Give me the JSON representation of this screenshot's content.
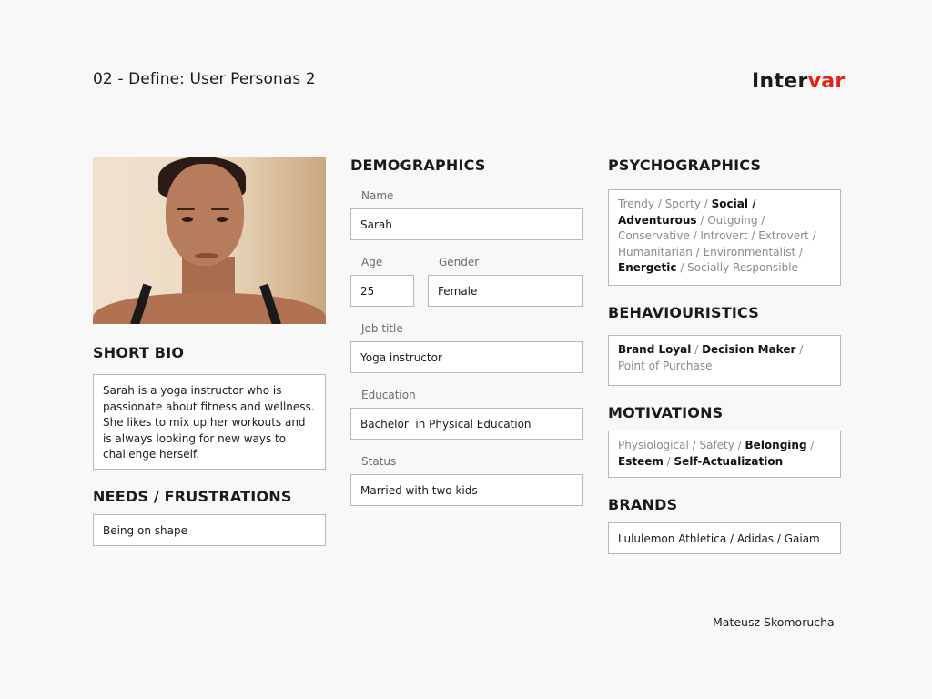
{
  "header": {
    "title": "02 - Define: User Personas 2",
    "logo": {
      "part1": "Inter",
      "part2": "var",
      "accent_color": "#e2231a"
    }
  },
  "left": {
    "photo_alt": "Portrait of Sarah",
    "bio_heading": "SHORT BIO",
    "bio_text": "Sarah is a yoga instructor who is passionate about fitness and wellness. She likes to mix up her workouts and is always looking for new ways to challenge herself.",
    "needs_heading": "NEEDS / FRUSTRATIONS",
    "needs_text": "Being on shape"
  },
  "demographics": {
    "heading": "DEMOGRAPHICS",
    "name": {
      "label": "Name",
      "value": "Sarah"
    },
    "age": {
      "label": "Age",
      "value": "25"
    },
    "gender": {
      "label": "Gender",
      "value": "Female"
    },
    "job": {
      "label": "Job title",
      "value": "Yoga instructor"
    },
    "education": {
      "label": "Education",
      "value": "Bachelor  in Physical Education"
    },
    "status": {
      "label": "Status",
      "value": "Married with two kids"
    }
  },
  "psychographics": {
    "heading": "PSYCHOGRAPHICS",
    "items": [
      {
        "text": "Trendy",
        "selected": false
      },
      {
        "text": "Sporty",
        "selected": false
      },
      {
        "text": "Social / Adventurous",
        "selected": true
      },
      {
        "text": "Outgoing ",
        "selected": false
      },
      {
        "text": "Conservative ",
        "selected": false
      },
      {
        "text": "Introvert ",
        "selected": false
      },
      {
        "text": "Extrovert",
        "selected": false
      },
      {
        "text": "Humanitarian",
        "selected": false
      },
      {
        "text": "Environmentalist",
        "selected": false
      },
      {
        "text": "Energetic",
        "selected": true
      },
      {
        "text": "Socially Responsible",
        "selected": false
      }
    ]
  },
  "behaviouristics": {
    "heading": "BEHAVIOURISTICS",
    "items": [
      {
        "text": "Brand Loyal",
        "selected": true
      },
      {
        "text": "Decision Maker",
        "selected": true
      },
      {
        "text": "Point of Purchase",
        "selected": false
      }
    ]
  },
  "motivations": {
    "heading": "MOTIVATIONS",
    "items": [
      {
        "text": "Physiological",
        "selected": false
      },
      {
        "text": "Safety",
        "selected": false
      },
      {
        "text": "Belonging",
        "selected": true
      },
      {
        "text": "Esteem",
        "selected": true
      },
      {
        "text": "Self-Actualization",
        "selected": true
      }
    ]
  },
  "brands": {
    "heading": "BRANDS",
    "text": "Lululemon Athletica / Adidas / Gaiam"
  },
  "footer": {
    "author": "Mateusz Skomorucha"
  }
}
